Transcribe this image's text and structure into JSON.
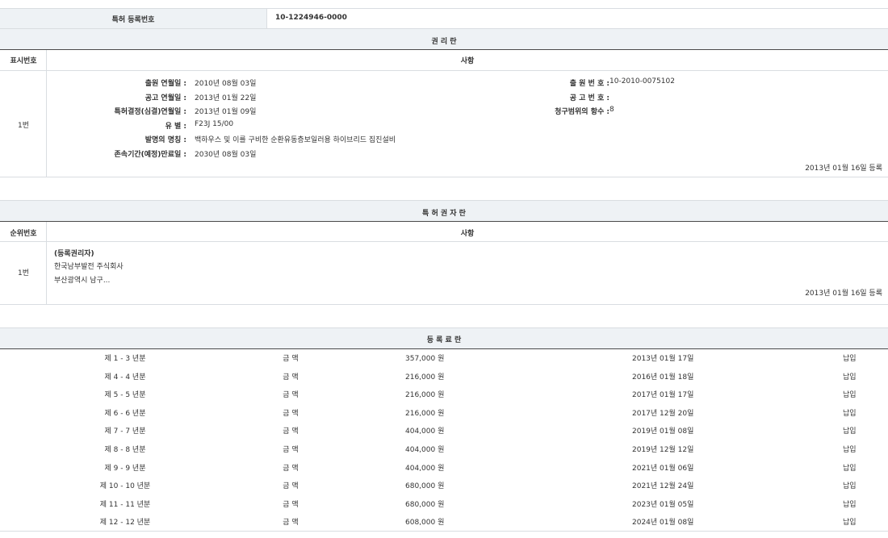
{
  "top": {
    "label": "특허 등록번호",
    "value": "10-1224946-0000"
  },
  "rights": {
    "title": "권 리 란",
    "col_no": "표시번호",
    "col_item": "사항",
    "row_no": "1번",
    "fields_left": [
      {
        "label": "출원 연월일 : ",
        "value": "2010년 08월 03일"
      },
      {
        "label": "공고 연월일 : ",
        "value": "2013년 01월 22일"
      },
      {
        "label": "특허결정(심결)연월일 : ",
        "value": "2013년 01월 09일"
      },
      {
        "label": "유 별 : ",
        "value": "F23J 15/00"
      },
      {
        "label": "발명의 명칭 : ",
        "value": "백하우스 및 이를 구비한 순환유동층보일러용 하이브리드 집진설비"
      },
      {
        "label": "존속기간(예정)만료일 : ",
        "value": "2030년 08월 03일"
      }
    ],
    "fields_right": [
      {
        "label": "출 원 번 호 : ",
        "value": "10-2010-0075102"
      },
      {
        "label": "공 고 번 호 : ",
        "value": ""
      },
      {
        "label": "청구범위의 항수 : ",
        "value": "8"
      }
    ],
    "reg_date": "2013년 01월 16일 등록"
  },
  "holders": {
    "title": "특 허 권 자 란",
    "col_no": "순위번호",
    "col_item": "사항",
    "row_no": "1번",
    "lines": [
      "(등록권리자)",
      "한국남부발전 주식회사",
      "부산광역시 남구..."
    ],
    "reg_date": "2013년 01월 16일 등록"
  },
  "fees": {
    "title": "등 록 료 란",
    "rows": [
      {
        "period": "제 1 - 3 년분",
        "label": "금 액",
        "amount": "357,000 원",
        "date": "2013년 01월 17일",
        "status": "납입"
      },
      {
        "period": "제 4 - 4 년분",
        "label": "금 액",
        "amount": "216,000 원",
        "date": "2016년 01월 18일",
        "status": "납입"
      },
      {
        "period": "제 5 - 5 년분",
        "label": "금 액",
        "amount": "216,000 원",
        "date": "2017년 01월 17일",
        "status": "납입"
      },
      {
        "period": "제 6 - 6 년분",
        "label": "금 액",
        "amount": "216,000 원",
        "date": "2017년 12월 20일",
        "status": "납입"
      },
      {
        "period": "제 7 - 7 년분",
        "label": "금 액",
        "amount": "404,000 원",
        "date": "2019년 01월 08일",
        "status": "납입"
      },
      {
        "period": "제 8 - 8 년분",
        "label": "금 액",
        "amount": "404,000 원",
        "date": "2019년 12월 12일",
        "status": "납입"
      },
      {
        "period": "제 9 - 9 년분",
        "label": "금 액",
        "amount": "404,000 원",
        "date": "2021년 01월 06일",
        "status": "납입"
      },
      {
        "period": "제 10 - 10 년분",
        "label": "금 액",
        "amount": "680,000 원",
        "date": "2021년 12월 24일",
        "status": "납입"
      },
      {
        "period": "제 11 - 11 년분",
        "label": "금 액",
        "amount": "680,000 원",
        "date": "2023년 01월 05일",
        "status": "납입"
      },
      {
        "period": "제 12 - 12 년분",
        "label": "금 액",
        "amount": "608,000 원",
        "date": "2024년 01월 08일",
        "status": "납입"
      }
    ]
  }
}
